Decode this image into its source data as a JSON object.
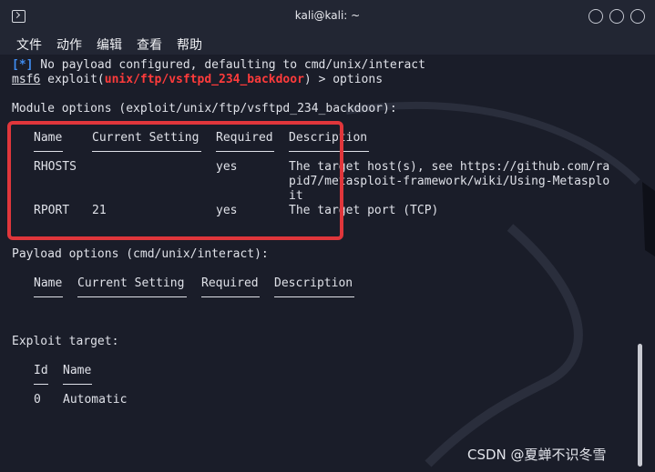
{
  "window": {
    "title": "kali@kali: ~"
  },
  "menu": [
    "文件",
    "动作",
    "编辑",
    "查看",
    "帮助"
  ],
  "terminal": {
    "info_tag": "[*]",
    "info_text": " No payload configured, defaulting to cmd/unix/interact",
    "prompt_prefix": "msf6",
    "prompt_mid": " exploit(",
    "prompt_module": "unix/ftp/vsftpd_234_backdoor",
    "prompt_command": ") > options",
    "module_heading": "Module options (exploit/unix/ftp/vsftpd_234_backdoor):",
    "module_table": {
      "headers": [
        "Name",
        "Current Setting",
        "Required",
        "Description"
      ],
      "rows": [
        {
          "name": "RHOSTS",
          "setting": "",
          "required": "yes",
          "description": [
            "The target host(s), see https://github.com/ra",
            "pid7/metasploit-framework/wiki/Using-Metasplo",
            "it"
          ]
        },
        {
          "name": "RPORT",
          "setting": "21",
          "required": "yes",
          "description": [
            "The target port (TCP)"
          ]
        }
      ]
    },
    "payload_heading": "Payload options (cmd/unix/interact):",
    "payload_table": {
      "headers": [
        "Name",
        "Current Setting",
        "Required",
        "Description"
      ]
    },
    "target_heading": "Exploit target:",
    "target_table": {
      "headers": [
        "Id",
        "Name"
      ],
      "rows": [
        {
          "id": "0",
          "name": "Automatic"
        }
      ]
    }
  },
  "watermark": "CSDN @夏蝉不识冬雪",
  "colors": {
    "background": "#1a1d29",
    "highlight_box": "#e0363b",
    "module_name": "#ff3b3b",
    "info_tag": "#3f8cf0"
  }
}
